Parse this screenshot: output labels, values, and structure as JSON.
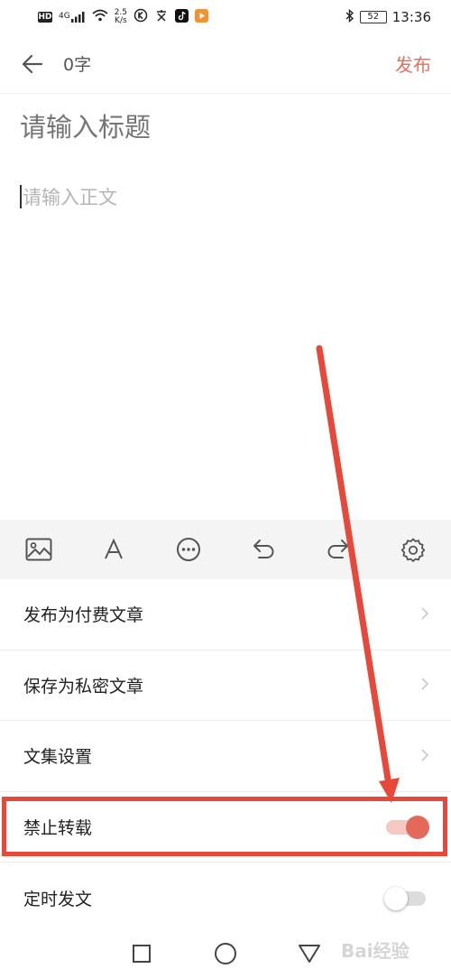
{
  "status_bar": {
    "hd": "HD",
    "signal": "4G",
    "speed_value": "2.5",
    "speed_unit": "K/s",
    "battery": "52",
    "time": "13:36",
    "icons": [
      "hd-icon",
      "signal-icon",
      "wifi-icon",
      "k-app-icon",
      "wenku-icon",
      "tiktok-icon",
      "video-app-icon",
      "bluetooth-icon",
      "battery-icon"
    ]
  },
  "header": {
    "back_icon": "arrow-left-icon",
    "word_count": "0字",
    "publish_label": "发布"
  },
  "editor": {
    "title_placeholder": "请输入标题",
    "body_placeholder": "请输入正文"
  },
  "toolbar": {
    "tools": [
      "image-icon",
      "font-icon",
      "more-icon",
      "undo-icon",
      "redo-icon",
      "settings-icon"
    ]
  },
  "menu": {
    "items": [
      {
        "label": "发布为付费文章",
        "control": "chevron"
      },
      {
        "label": "保存为私密文章",
        "control": "chevron"
      },
      {
        "label": "文集设置",
        "control": "chevron"
      },
      {
        "label": "禁止转载",
        "control": "toggle",
        "state": "on"
      },
      {
        "label": "定时发文",
        "control": "toggle",
        "state": "off"
      }
    ]
  },
  "colors": {
    "accent": "#ea6f5a",
    "toggle_on": "#e3695a",
    "annotation": "#e8483a",
    "toolbar_bg": "#f4f4f4",
    "placeholder": "#b5b5b5"
  },
  "nav_bar": {
    "buttons": [
      "recent-apps-icon",
      "home-icon",
      "back-triangle-icon"
    ]
  },
  "watermark": "Bai经验"
}
